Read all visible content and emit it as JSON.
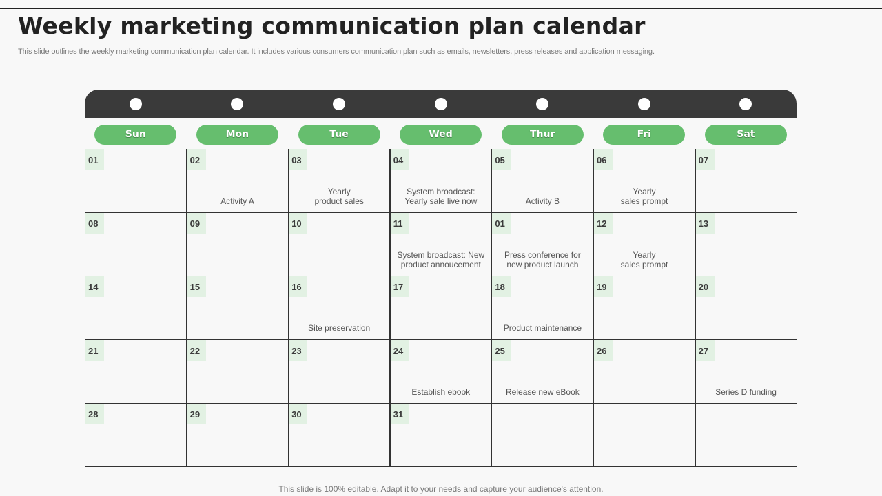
{
  "slide": {
    "title": "Weekly marketing communication plan calendar",
    "subtitle": "This slide outlines the weekly marketing communication plan calendar. It includes various consumers communication plan such as emails, newsletters, press releases and application messaging.",
    "footer": "This slide is 100% editable. Adapt it to your needs and capture your audience's attention."
  },
  "colors": {
    "accent_green": "#66be6e",
    "day_number_bg": "#e2f1e3",
    "binder_dark": "#3a3a3a"
  },
  "calendar": {
    "weekdays": [
      "Sun",
      "Mon",
      "Tue",
      "Wed",
      "Thur",
      "Fri",
      "Sat"
    ],
    "weeks": [
      [
        {
          "day": "01",
          "event": ""
        },
        {
          "day": "02",
          "event": "Activity  A"
        },
        {
          "day": "03",
          "event": "Yearly\nproduct sales"
        },
        {
          "day": "04",
          "event": "System broadcast:\nYearly sale live now"
        },
        {
          "day": "05",
          "event": "Activity  B"
        },
        {
          "day": "06",
          "event": "Yearly\nsales prompt"
        },
        {
          "day": "07",
          "event": ""
        }
      ],
      [
        {
          "day": "08",
          "event": ""
        },
        {
          "day": "09",
          "event": ""
        },
        {
          "day": "10",
          "event": ""
        },
        {
          "day": "11",
          "event": "System broadcast: New\nproduct annoucement"
        },
        {
          "day": "01",
          "event": "Press conference for\nnew product launch"
        },
        {
          "day": "12",
          "event": "Yearly\nsales prompt"
        },
        {
          "day": "13",
          "event": ""
        }
      ],
      [
        {
          "day": "14",
          "event": ""
        },
        {
          "day": "15",
          "event": ""
        },
        {
          "day": "16",
          "event": "Site preservation"
        },
        {
          "day": "17",
          "event": ""
        },
        {
          "day": "18",
          "event": "Product maintenance"
        },
        {
          "day": "19",
          "event": ""
        },
        {
          "day": "20",
          "event": ""
        }
      ],
      [
        {
          "day": "21",
          "event": ""
        },
        {
          "day": "22",
          "event": ""
        },
        {
          "day": "23",
          "event": ""
        },
        {
          "day": "24",
          "event": "Establish ebook"
        },
        {
          "day": "25",
          "event": "Release new eBook"
        },
        {
          "day": "26",
          "event": ""
        },
        {
          "day": "27",
          "event": "Series D  funding"
        }
      ],
      [
        {
          "day": "28",
          "event": ""
        },
        {
          "day": "29",
          "event": ""
        },
        {
          "day": "30",
          "event": ""
        },
        {
          "day": "31",
          "event": ""
        },
        {
          "day": "",
          "event": ""
        },
        {
          "day": "",
          "event": ""
        },
        {
          "day": "",
          "event": ""
        }
      ]
    ]
  }
}
